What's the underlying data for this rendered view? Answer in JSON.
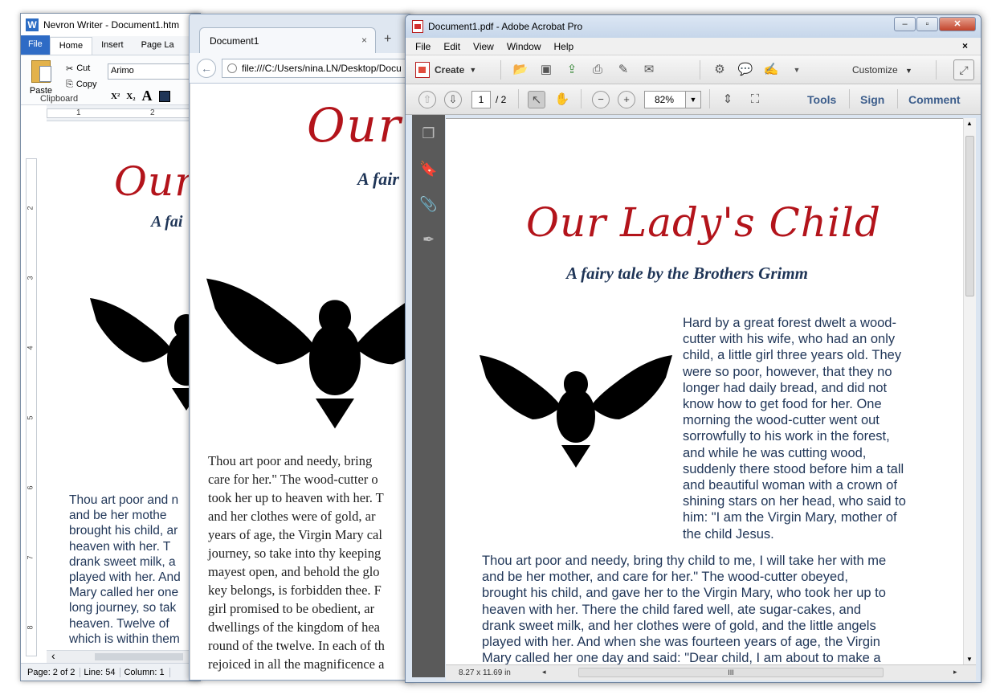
{
  "writer": {
    "title": "Nevron Writer - Document1.htm",
    "tabs": [
      "File",
      "Home",
      "Insert",
      "Page La"
    ],
    "paste_label": "Paste",
    "cut_label": "Cut",
    "copy_label": "Copy",
    "font_name": "Arimo",
    "clipboard_group": "Clipboard",
    "ruler_marks": [
      "1",
      "2"
    ],
    "vruler_marks": [
      "2",
      "3",
      "4",
      "5",
      "6",
      "7",
      "8"
    ],
    "doc_title": "Our",
    "doc_subtitle": "A fai",
    "body_lines": [
      "Thou art poor and n",
      "and be her mothe",
      "brought his child, ar",
      "heaven with her. T",
      "drank sweet milk, a",
      "played with her. And",
      "Mary called her one",
      "long journey, so tak",
      "heaven. Twelve of",
      "which is within them"
    ],
    "status": [
      "Page: 2 of 2",
      "Line: 54",
      "Column: 1"
    ]
  },
  "browser": {
    "tab_title": "Document1",
    "tab_close": "×",
    "new_tab": "+",
    "url": "file:///C:/Users/nina.LN/Desktop/Docu",
    "doc_title": "Our",
    "doc_subtitle": "A fair",
    "body_lines": [
      "Thou art poor and needy, bring",
      "care for her.\" The wood-cutter o",
      "took her up to heaven with her. T",
      "and her clothes were of gold, ar",
      "years of age, the Virgin Mary cal",
      "journey, so take into thy keeping",
      "mayest open, and behold the glo",
      "key belongs, is forbidden thee. F",
      "girl promised to be obedient, ar",
      "dwellings of the kingdom of hea",
      "round of the twelve. In each of th",
      "rejoiced in all the magnificence a"
    ]
  },
  "acrobat": {
    "title": "Document1.pdf - Adobe Acrobat Pro",
    "menu": [
      "File",
      "Edit",
      "View",
      "Window",
      "Help"
    ],
    "menu_close": "×",
    "create_label": "Create",
    "customize_label": "Customize",
    "page_current": "1",
    "page_total": "/ 2",
    "zoom": "82%",
    "tool_links": [
      "Tools",
      "Sign",
      "Comment"
    ],
    "doc_title": "Our Lady's Child",
    "doc_subtitle": "A fairy tale by the Brothers Grimm",
    "para1_lines": [
      "Hard by a great forest dwelt a wood-",
      "cutter with his wife, who had an only",
      "child, a little girl three years old. They",
      "were so poor, however, that they no",
      "longer had daily bread, and did not",
      "know how to get food for her. One",
      "morning the wood-cutter went out",
      "sorrowfully to his work in the forest,",
      "and while he was cutting wood,",
      "suddenly there stood before him a tall",
      "and beautiful woman with a crown of",
      "shining stars on her head, who said to",
      "him: \"I am the Virgin Mary, mother of",
      "the child Jesus."
    ],
    "para2_lines": [
      "Thou art poor and needy, bring thy child to me, I will take her with me",
      "and be her mother, and care for her.\" The wood-cutter obeyed,",
      "brought his child, and gave her to the Virgin Mary, who took her up to",
      "heaven with her. There the child fared well, ate sugar-cakes, and",
      "drank sweet milk, and her clothes were of gold, and the little angels",
      "played with her. And when she was fourteen years of age, the Virgin",
      "Mary called her one day and said: \"Dear child, I am about to make a"
    ],
    "page_size": "8.27 x 11.69 in"
  },
  "colors": {
    "title_red": "#b3141b",
    "text_navy": "#1f3557",
    "link_blue": "#3d5e8c"
  },
  "icons": [
    "word-logo-icon",
    "paste-icon",
    "cut-icon",
    "copy-icon",
    "back-arrow-icon",
    "pdf-icon",
    "open-icon",
    "save-icon",
    "upload-icon",
    "print-icon",
    "edit-icon",
    "mail-icon",
    "gear-icon",
    "comment-icon",
    "sign-icon",
    "fullscreen-icon",
    "prev-page-icon",
    "next-page-icon",
    "select-tool-icon",
    "hand-tool-icon",
    "zoom-out-icon",
    "zoom-in-icon",
    "fit-width-icon",
    "fit-page-icon",
    "pages-panel-icon",
    "bookmarks-icon",
    "attachments-icon",
    "signatures-icon",
    "eagle-image"
  ]
}
